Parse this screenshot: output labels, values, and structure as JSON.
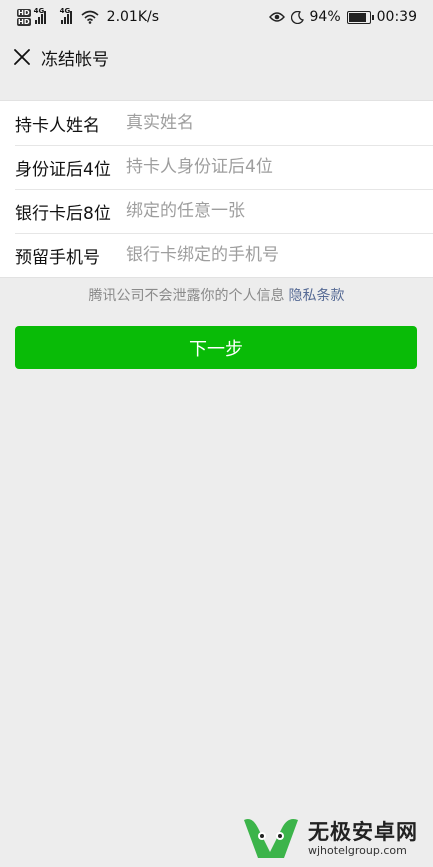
{
  "status_bar": {
    "hd_badges": [
      "HD",
      "HD"
    ],
    "net_tags": [
      "4G",
      "4G"
    ],
    "speed": "2.01K/s",
    "battery": "94%",
    "battery_level": 0.94,
    "time": "00:39"
  },
  "header": {
    "title": "冻结帐号"
  },
  "form": {
    "rows": [
      {
        "label": "持卡人姓名",
        "placeholder": "真实姓名"
      },
      {
        "label": "身份证后4位",
        "placeholder": "持卡人身份证后4位"
      },
      {
        "label": "银行卡后8位",
        "placeholder": "绑定的任意一张"
      },
      {
        "label": "预留手机号",
        "placeholder": "银行卡绑定的手机号"
      }
    ]
  },
  "privacy": {
    "text": "腾讯公司不会泄露你的个人信息",
    "link": "隐私条款"
  },
  "next_button": {
    "label": "下一步",
    "color": "#09bb07"
  },
  "watermark": {
    "title": "无极安卓网",
    "url": "wjhotelgroup.com"
  }
}
